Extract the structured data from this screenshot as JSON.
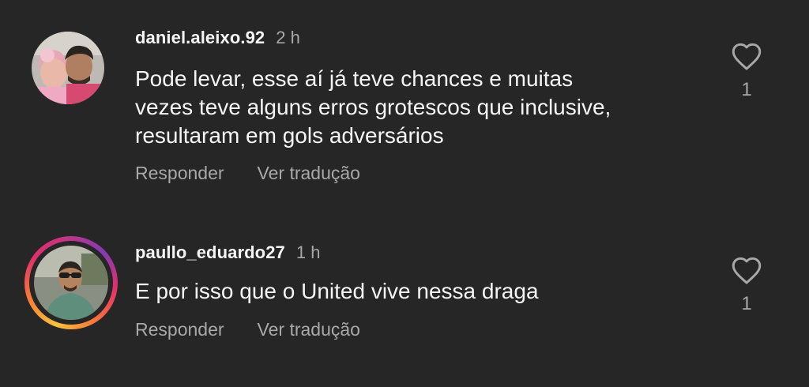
{
  "comments": [
    {
      "username": "daniel.aleixo.92",
      "time": "2 h",
      "text_lines": [
        "Pode levar, esse aí já teve chances e muitas",
        "vezes teve alguns erros grotescos que inclusive,",
        "resultaram em gols adversários"
      ],
      "reply_label": "Responder",
      "translate_label": "Ver tradução",
      "like_count": "1",
      "like_icon": "heart-outline-icon",
      "has_story_ring": false
    },
    {
      "username": "paullo_eduardo27",
      "time": "1 h",
      "text_lines": [
        "E por isso que o United vive nessa draga"
      ],
      "reply_label": "Responder",
      "translate_label": "Ver tradução",
      "like_count": "1",
      "like_icon": "heart-outline-icon",
      "has_story_ring": true
    }
  ],
  "colors": {
    "background": "#262626",
    "primary_text": "#f5f5f5",
    "secondary_text": "#a8a8a8",
    "story_ring": [
      "#f9c23c",
      "#f77737",
      "#e1306c",
      "#c13584",
      "#833ab4"
    ]
  }
}
